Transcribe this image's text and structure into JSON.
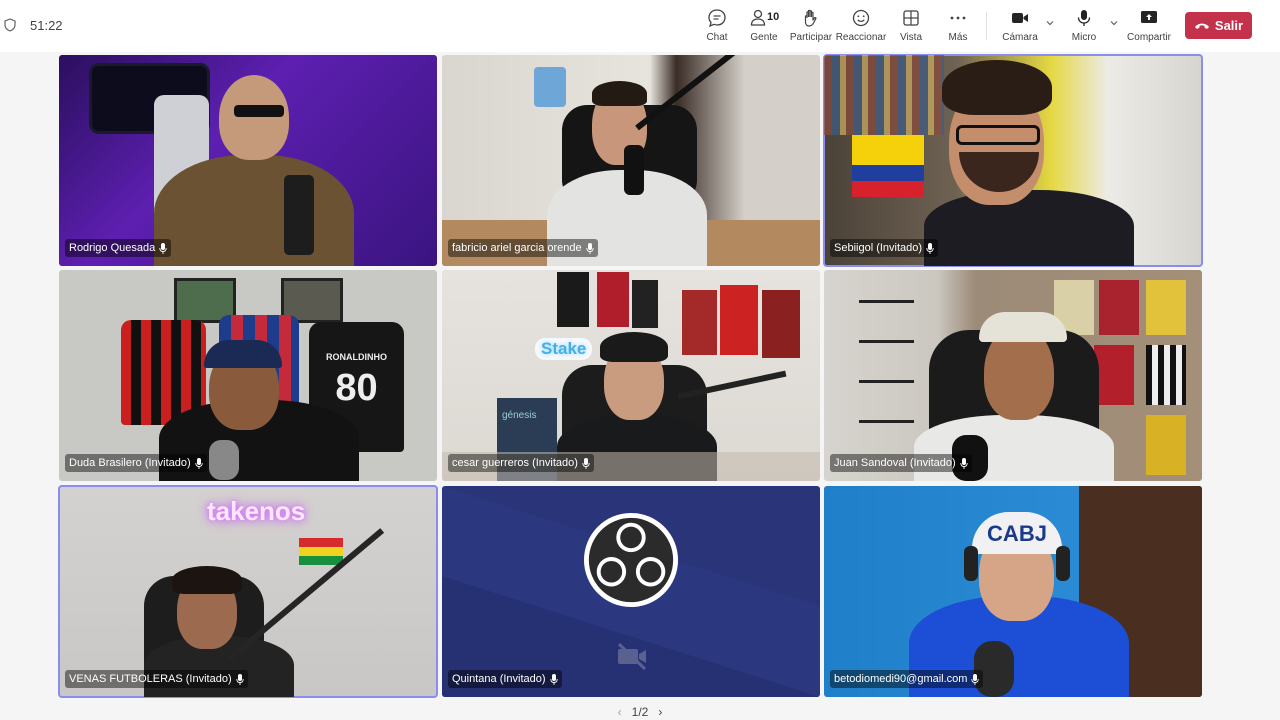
{
  "meeting": {
    "timer": "51:22"
  },
  "toolbar": {
    "chat_label": "Chat",
    "people_label": "Gente",
    "people_count": "10",
    "raise_label": "Participar",
    "react_label": "Reaccionar",
    "view_label": "Vista",
    "more_label": "Más",
    "camera_label": "Cámara",
    "mic_label": "Micro",
    "share_label": "Compartir",
    "leave_label": "Salir"
  },
  "participants": [
    {
      "name": "Rodrigo Quesada"
    },
    {
      "name": "fabricio ariel garcia orende"
    },
    {
      "name": "Sebiigol (Invitado)"
    },
    {
      "name": "Duda Brasilero (Invitado)"
    },
    {
      "name": "cesar guerreros (Invitado)"
    },
    {
      "name": "Juan Sandoval (Invitado)"
    },
    {
      "name": "VENAS FUTBOLERAS (Invitado)"
    },
    {
      "name": "Quintana (Invitado)"
    },
    {
      "name": "betodiomedi90@gmail.com"
    }
  ],
  "tile_text": {
    "takenos_sign": "takenos",
    "stake_sign": "Stake",
    "genesis_text": "génesis",
    "cap_text": "CABJ",
    "jersey_80": "80",
    "jersey_ronaldinho": "RONALDINHO"
  },
  "pager": {
    "label": "1/2"
  },
  "colors": {
    "leave_red": "#c4314b",
    "active_border": "#8b8cf0",
    "obs_background": "#2a3478"
  }
}
